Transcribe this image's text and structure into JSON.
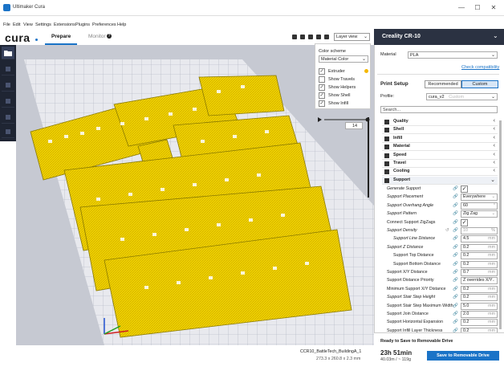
{
  "window": {
    "title": "Ultimaker Cura",
    "min": "—",
    "max": "☐",
    "close": "✕"
  },
  "menu": [
    "File",
    "Edit",
    "View",
    "Settings",
    "Extensions",
    "Plugins",
    "Preferences",
    "Help"
  ],
  "brand": "cura",
  "stages": {
    "prepare": "Prepare",
    "monitor": "Monitor",
    "help": "?"
  },
  "view": {
    "selected": "Layer view"
  },
  "color_scheme": {
    "title": "Color scheme",
    "selected": "Material Color",
    "items": [
      {
        "label": "Extruder",
        "checked": true
      },
      {
        "label": "Show Travels",
        "checked": false
      },
      {
        "label": "Show Helpers",
        "checked": true
      },
      {
        "label": "Show Shell",
        "checked": true
      },
      {
        "label": "Show Infill",
        "checked": true
      }
    ],
    "extruder_color": "#f5b800"
  },
  "layer": {
    "value": "14"
  },
  "printer": {
    "name": "Creality CR-10"
  },
  "material": {
    "label": "Material",
    "value": "PLA",
    "link": "Check compatibility"
  },
  "print_setup": {
    "title": "Print Setup",
    "recommended": "Recommended",
    "custom": "Custom",
    "profile_label": "Profile:",
    "profile_value": "cura_v2",
    "profile_suffix": "Custom",
    "search_placeholder": "Search..."
  },
  "categories": [
    "Quality",
    "Shell",
    "Infill",
    "Material",
    "Speed",
    "Travel",
    "Cooling",
    "Support"
  ],
  "support_settings": [
    {
      "label": "Generate Support",
      "type": "check",
      "value": "✓",
      "italic": true,
      "indent": 0
    },
    {
      "label": "Support Placement",
      "type": "select",
      "value": "Everywhere",
      "italic": true,
      "indent": 0
    },
    {
      "label": "Support Overhang Angle",
      "type": "num",
      "value": "60",
      "unit": "°",
      "italic": true,
      "indent": 0
    },
    {
      "label": "Support Pattern",
      "type": "select",
      "value": "Zig Zag",
      "italic": true,
      "indent": 0
    },
    {
      "label": "Connect Support ZigZags",
      "type": "check",
      "value": "✓",
      "italic": false,
      "indent": 0
    },
    {
      "label": "Support Density",
      "type": "num",
      "value": "10",
      "unit": "%",
      "italic": true,
      "indent": 0
    },
    {
      "label": "Support Line Distance",
      "type": "num",
      "value": "4.5",
      "unit": "mm",
      "italic": true,
      "indent": 1
    },
    {
      "label": "Support Z Distance",
      "type": "num",
      "value": "0.2",
      "unit": "mm",
      "italic": true,
      "indent": 0
    },
    {
      "label": "Support Top Distance",
      "type": "num",
      "value": "0.2",
      "unit": "mm",
      "italic": false,
      "indent": 1
    },
    {
      "label": "Support Bottom Distance",
      "type": "num",
      "value": "0.2",
      "unit": "mm",
      "italic": false,
      "indent": 1
    },
    {
      "label": "Support X/Y Distance",
      "type": "num",
      "value": "0.7",
      "unit": "mm",
      "italic": false,
      "indent": 0
    },
    {
      "label": "Support Distance Priority",
      "type": "select",
      "value": "Z overrides X/Y",
      "italic": false,
      "indent": 0
    },
    {
      "label": "Minimum Support X/Y Distance",
      "type": "num",
      "value": "0.2",
      "unit": "mm",
      "italic": false,
      "indent": 0
    },
    {
      "label": "Support Stair Step Height",
      "type": "num",
      "value": "0.2",
      "unit": "mm",
      "italic": true,
      "indent": 0
    },
    {
      "label": "Support Stair Step Maximum Width",
      "type": "num",
      "value": "5.0",
      "unit": "mm",
      "italic": false,
      "indent": 0
    },
    {
      "label": "Support Join Distance",
      "type": "num",
      "value": "2.0",
      "unit": "mm",
      "italic": false,
      "indent": 0
    },
    {
      "label": "Support Horizontal Expansion",
      "type": "num",
      "value": "0.2",
      "unit": "mm",
      "italic": false,
      "indent": 0
    },
    {
      "label": "Support Infill Layer Thickness",
      "type": "num",
      "value": "0.2",
      "unit": "mm",
      "italic": false,
      "indent": 0
    }
  ],
  "footer": {
    "status": "Ready to Save to Removable Drive",
    "time": "23h 51min",
    "usage": "40.03m / ~ 119g",
    "save_button": "Save to Removable Drive",
    "model_name": "CCR10_BattleTech_BuildingA_1",
    "model_size": "273.3 x 260.8 x 2.3 mm"
  },
  "colors": {
    "accent": "#1a73c7",
    "print": "#f0d000",
    "panel_dark": "#2b3242"
  }
}
